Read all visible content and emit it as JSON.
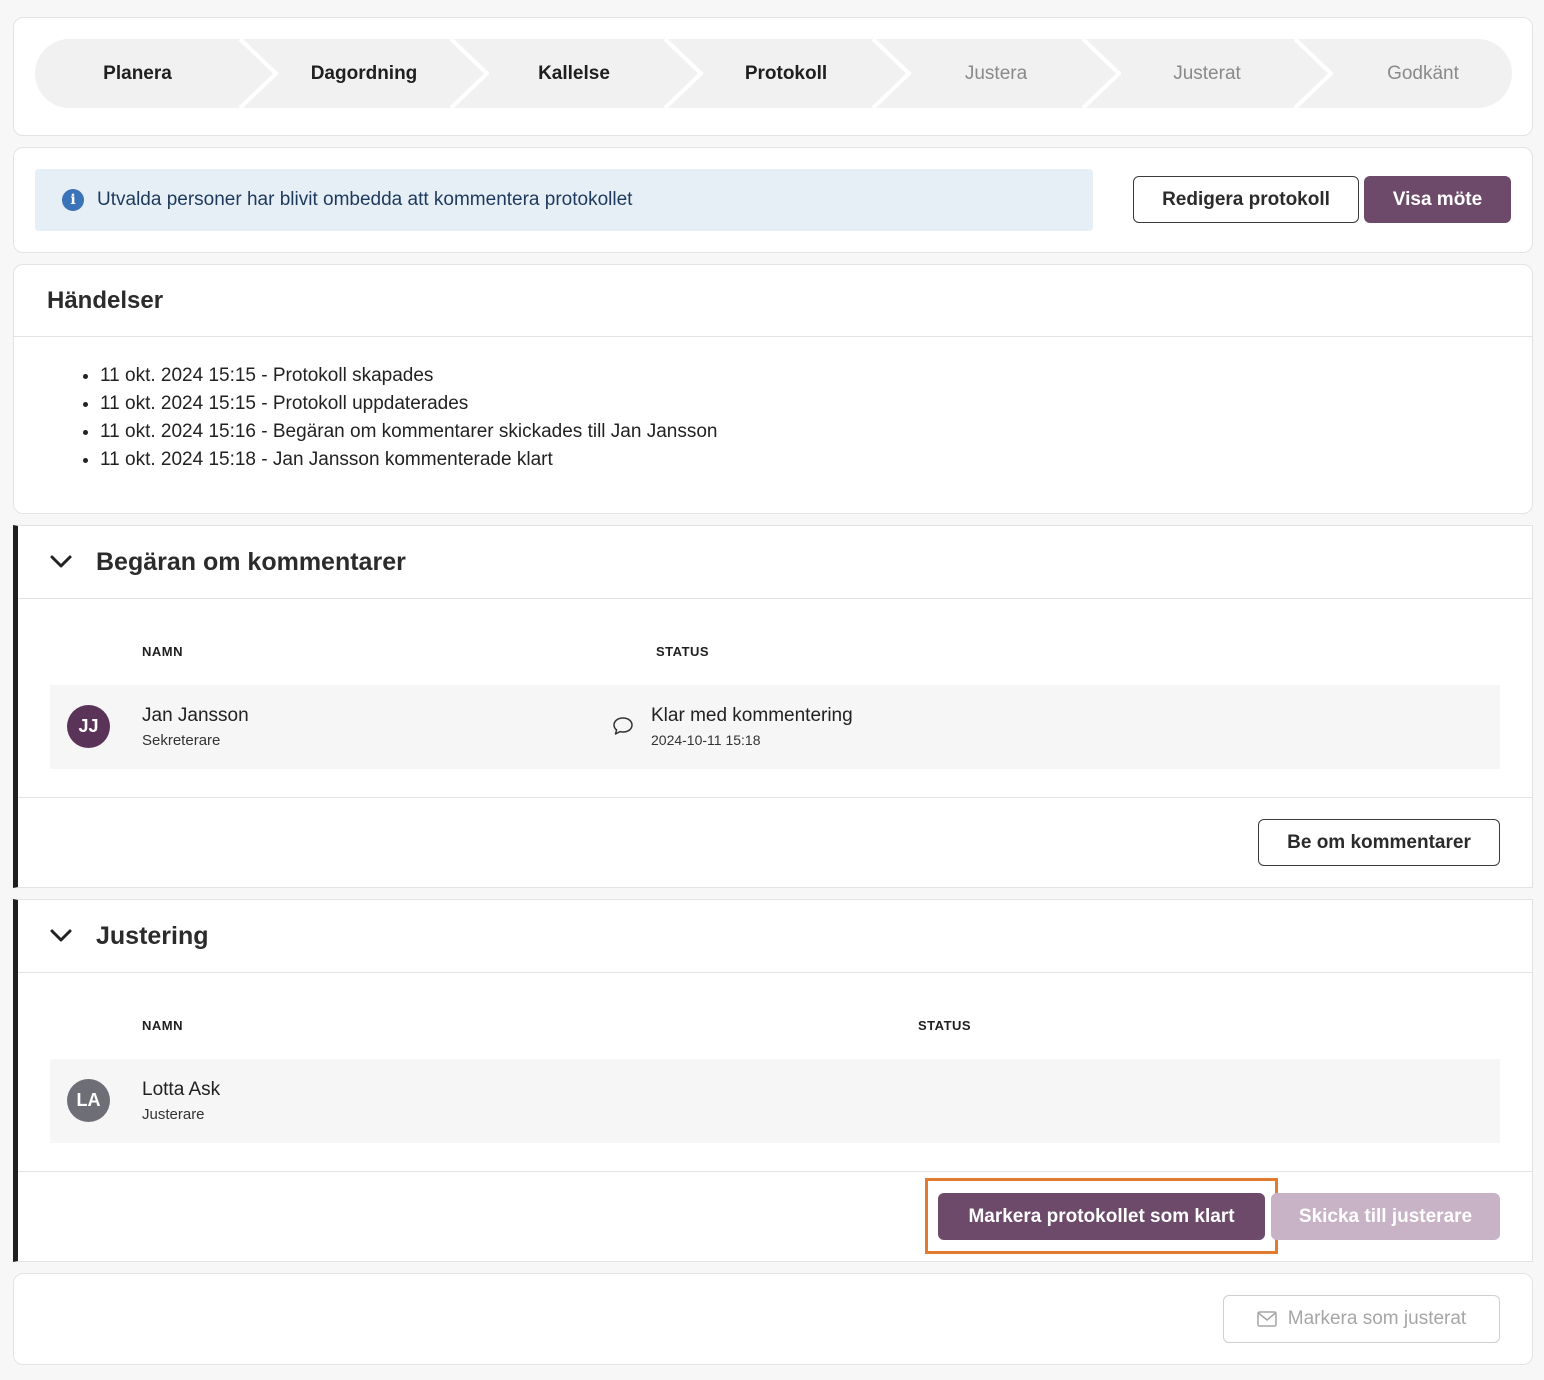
{
  "stepper": {
    "steps": [
      {
        "label": "Planera",
        "state": "done"
      },
      {
        "label": "Dagordning",
        "state": "done"
      },
      {
        "label": "Kallelse",
        "state": "done"
      },
      {
        "label": "Protokoll",
        "state": "done"
      },
      {
        "label": "Justera",
        "state": "todo"
      },
      {
        "label": "Justerat",
        "state": "todo"
      },
      {
        "label": "Godkänt",
        "state": "todo"
      }
    ]
  },
  "info": {
    "icon": "info-icon",
    "message": "Utvalda personer har blivit ombedda att kommentera protokollet",
    "edit_button": "Redigera protokoll",
    "view_button": "Visa möte"
  },
  "events": {
    "title": "Händelser",
    "items": [
      "11 okt. 2024 15:15 - Protokoll skapades",
      "11 okt. 2024 15:15 - Protokoll uppdaterades",
      "11 okt. 2024 15:16 - Begäran om kommentarer skickades till Jan Jansson",
      "11 okt. 2024 15:18 - Jan Jansson kommenterade klart"
    ]
  },
  "comments": {
    "title": "Begäran om kommentarer",
    "col_name": "NAMN",
    "col_status": "STATUS",
    "rows": [
      {
        "initials": "JJ",
        "name": "Jan Jansson",
        "role": "Sekreterare",
        "status_icon": "comment-icon",
        "status": "Klar med kommentering",
        "status_date": "2024-10-11 15:18"
      }
    ],
    "request_button": "Be om kommentarer"
  },
  "adjust": {
    "title": "Justering",
    "col_name": "NAMN",
    "col_status": "STATUS",
    "rows": [
      {
        "initials": "LA",
        "name": "Lotta Ask",
        "role": "Justerare"
      }
    ],
    "mark_ready_button": "Markera protokollet som klart",
    "send_button": "Skicka till justerare"
  },
  "bottom": {
    "mark_adjusted_button": "Markera som justerat",
    "icon": "envelope-icon"
  },
  "colors": {
    "primary": "#6d4a6a",
    "primary_disabled": "#c8b3c6",
    "info_bg": "#e6eef6",
    "info_icon": "#3a73b8",
    "avatar_jj": "#5a3358",
    "avatar_la": "#6e6e76",
    "highlight": "#e27a30"
  }
}
